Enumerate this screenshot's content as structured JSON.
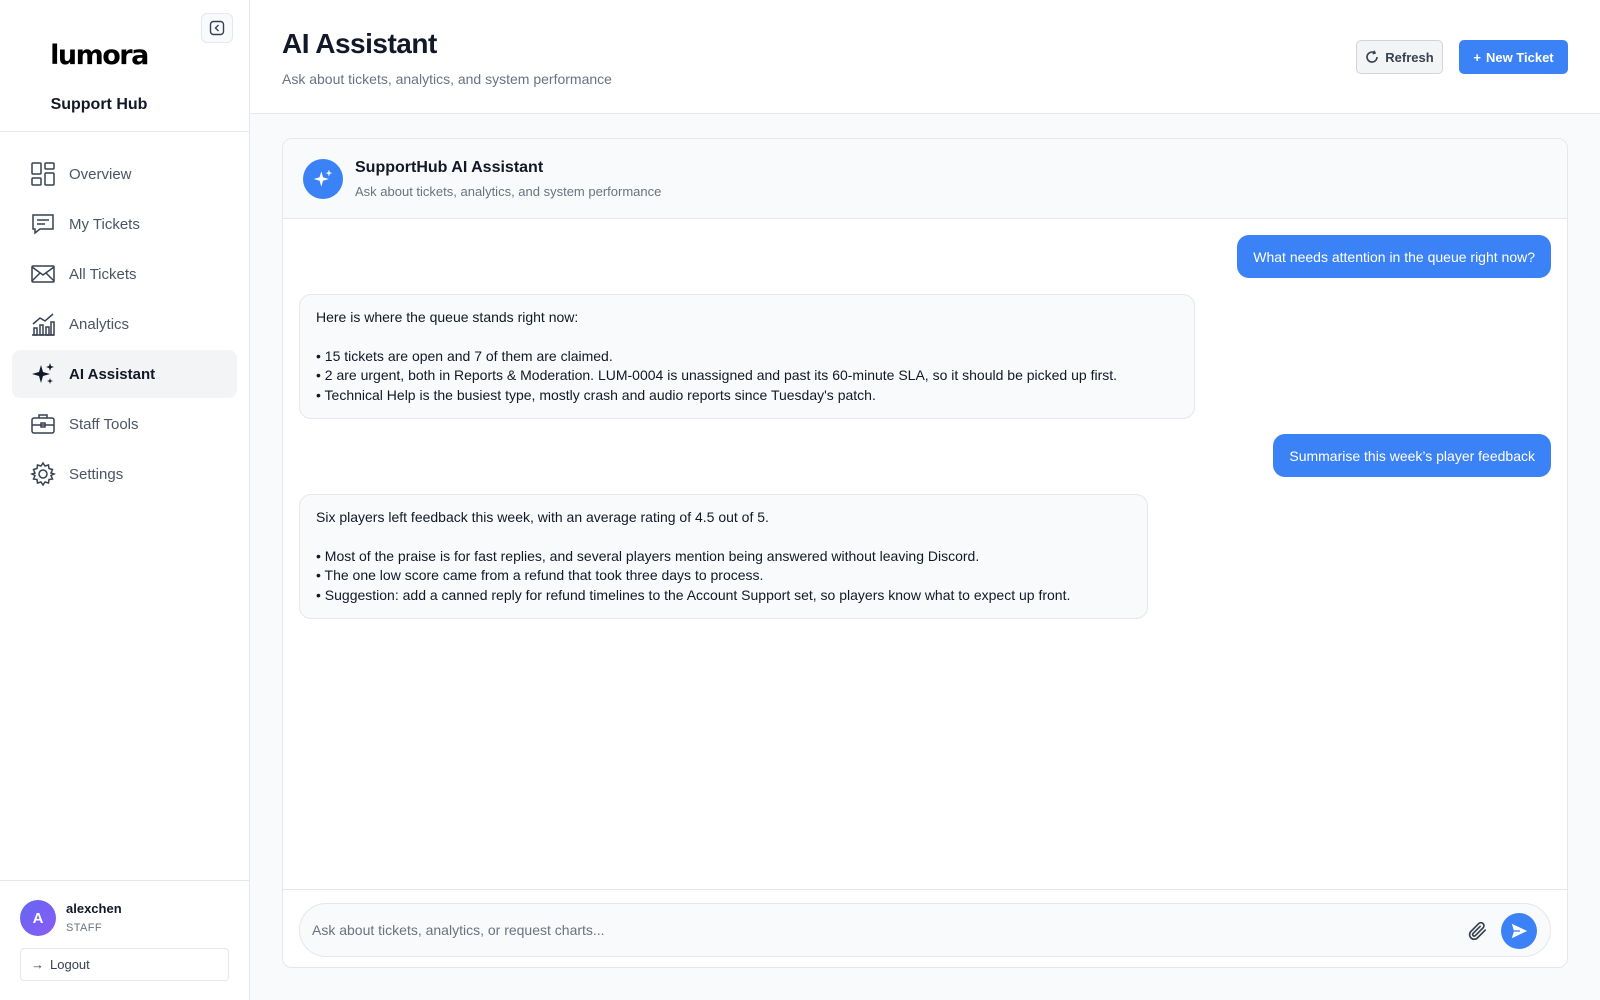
{
  "brand": {
    "logo_text": "lumora",
    "subtitle": "Support Hub"
  },
  "sidebar": {
    "items": [
      {
        "label": "Overview",
        "icon": "dashboard-icon",
        "active": false
      },
      {
        "label": "My Tickets",
        "icon": "chat-icon",
        "active": false
      },
      {
        "label": "All Tickets",
        "icon": "mail-icon",
        "active": false
      },
      {
        "label": "Analytics",
        "icon": "chart-icon",
        "active": false
      },
      {
        "label": "AI Assistant",
        "icon": "sparkle-icon",
        "active": true
      },
      {
        "label": "Staff Tools",
        "icon": "briefcase-icon",
        "active": false
      },
      {
        "label": "Settings",
        "icon": "gear-icon",
        "active": false
      }
    ]
  },
  "user": {
    "initial": "A",
    "name": "alexchen",
    "role": "STAFF",
    "logout_label": "Logout"
  },
  "header": {
    "title": "AI Assistant",
    "subtitle": "Ask about tickets, analytics, and system performance",
    "refresh_label": "Refresh",
    "new_ticket_label": "New Ticket"
  },
  "chat": {
    "title": "SupportHub AI Assistant",
    "subtitle": "Ask about tickets, analytics, and system performance",
    "messages": [
      {
        "role": "user",
        "text": "What needs attention in the queue right now?"
      },
      {
        "role": "assistant",
        "intro": "Here is where the queue stands right now:",
        "bullets": [
          "• 15 tickets are open and 7 of them are claimed.",
          "• 2 are urgent, both in Reports & Moderation. LUM-0004 is unassigned and past its 60-minute SLA, so it should be picked up first.",
          "• Technical Help is the busiest type, mostly crash and audio reports since Tuesday's patch."
        ]
      },
      {
        "role": "user",
        "text": "Summarise this week’s player feedback"
      },
      {
        "role": "assistant",
        "intro": "Six players left feedback this week, with an average rating of 4.5 out of 5.",
        "bullets": [
          "• Most of the praise is for fast replies, and several players mention being answered without leaving Discord.",
          "• The one low score came from a refund that took three days to process.",
          "• Suggestion: add a canned reply for refund timelines to the Account Support set, so players know what to expect up front."
        ]
      }
    ],
    "input_placeholder": "Ask about tickets, analytics, or request charts...",
    "input_value": ""
  },
  "colors": {
    "accent": "#3b82f6",
    "sidebar_active_bg": "#f3f4f6",
    "text_muted": "#6b7280"
  }
}
